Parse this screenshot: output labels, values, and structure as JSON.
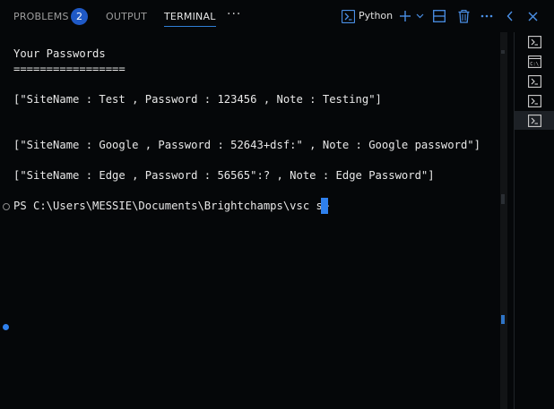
{
  "tabs": {
    "problems": "PROBLEMS",
    "problems_count": "2",
    "output": "OUTPUT",
    "terminal": "TERMINAL",
    "more": "···"
  },
  "toolbar": {
    "profile_label": "Python",
    "icons": [
      "terminal-icon",
      "plus-icon",
      "chevron-down-icon",
      "split-icon",
      "trash-icon",
      "ellipsis-icon",
      "chevron-left-icon",
      "close-icon"
    ]
  },
  "terminal": {
    "lines": [
      "Your Passwords",
      "=================",
      "[\"SiteName : Test , Password : 123456 , Note : Testing\"]",
      "[\"SiteName : Google , Password : 52643+dsf:\" , Note : Google password\"]",
      "[\"SiteName : Edge , Password : 56565\":? , Note : Edge Password\"]",
      "PS C:\\Users\\MESSIE\\Documents\\Brightchamps\\vsc s>"
    ]
  },
  "colors": {
    "background": "#050709",
    "accent": "#2f80ed",
    "badge": "#1f59c6",
    "text": "#e8e8e8"
  }
}
